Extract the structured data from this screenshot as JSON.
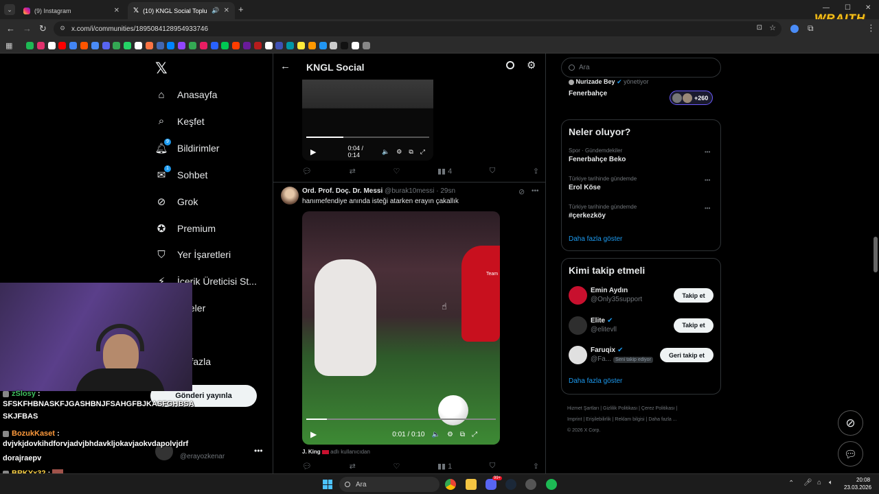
{
  "browser": {
    "tabs": [
      {
        "title": "(9) Instagram"
      },
      {
        "title": "(10) KNGL Social Topluluk /"
      }
    ],
    "url": "x.com/i/communities/1895084128954933746",
    "watermark": "WRAITH"
  },
  "nav": {
    "items": [
      {
        "label": "Anasayfa",
        "icon": "home-icon",
        "badge": ""
      },
      {
        "label": "Keşfet",
        "icon": "search-icon",
        "badge": ""
      },
      {
        "label": "Bildirimler",
        "icon": "bell-icon",
        "badge": "9"
      },
      {
        "label": "Sohbet",
        "icon": "mail-icon",
        "badge": "1"
      },
      {
        "label": "Grok",
        "icon": "grok-icon",
        "badge": ""
      },
      {
        "label": "Premium",
        "icon": "premium-icon",
        "badge": ""
      },
      {
        "label": "Yer İşaretleri",
        "icon": "bookmark-icon",
        "badge": ""
      },
      {
        "label": "İçerik Üreticisi St...",
        "icon": "creator-icon",
        "badge": ""
      },
      {
        "label": "kaleler",
        "icon": "articles-icon",
        "badge": ""
      },
      {
        "label": "fil",
        "icon": "profile-icon",
        "badge": ""
      },
      {
        "label": "ha fazla",
        "icon": "more-icon",
        "badge": ""
      }
    ],
    "post_button": "Gönderi yayınla",
    "account_name": "dorajraepv",
    "account_handle": "@erayozkenar"
  },
  "header": {
    "title": "KNGL Social"
  },
  "tweets": [
    {
      "video_time": "0:04 / 0:14",
      "video_progress": 0.3,
      "views": "4"
    },
    {
      "author": "Ord. Prof. Doç. Dr. Messi",
      "handle": "@burak10messi",
      "time": "· 29sn",
      "text": "hanımefendiye anında isteği atarken erayın çakallık",
      "video_time": "0:01 / 0:10",
      "video_progress": 0.11,
      "views": "1",
      "player_text": "Team"
    }
  ],
  "reply_bar": {
    "name": "J. King",
    "sub": "adlı kullanıcıdan"
  },
  "search": {
    "placeholder": "Ara"
  },
  "community": {
    "owner": "Nurizade Bey",
    "owner_suffix": "yönetiyor",
    "name": "Fenerbahçe",
    "members": "+260"
  },
  "trends": {
    "title": "Neler oluyor?",
    "items": [
      {
        "category": "Spor · Gündemdekiler",
        "name": "Fenerbahçe Beko"
      },
      {
        "category": "Türkiye tarihinde gündemde",
        "name": "Erol Köse"
      },
      {
        "category": "Türkiye tarihinde gündemde",
        "name": "#çerkezköy"
      }
    ],
    "more": "Daha fazla göster"
  },
  "who_to_follow": {
    "title": "Kimi takip etmeli",
    "items": [
      {
        "name": "Emin Aydın",
        "handle": "@Only35support",
        "button": "Takip et",
        "verified": false,
        "note": ""
      },
      {
        "name": "Elite",
        "handle": "@elitevll",
        "button": "Takip et",
        "verified": true,
        "note": ""
      },
      {
        "name": "Faruqix",
        "handle": "@Fa...",
        "button": "Geri takip et",
        "verified": true,
        "note": "Seni takip ediyor"
      }
    ],
    "more": "Daha fazla göster"
  },
  "footer": {
    "links": [
      "Hizmet Şartları",
      "Gizlilik Politikası",
      "Çerez Politikası",
      "Imprint",
      "Erişilebilirlik",
      "Reklam bilgisi",
      "Daha fazla ..."
    ],
    "copyright": "© 2026 X Corp."
  },
  "chat": [
    {
      "user": "zSlosy",
      "message": "SFSKFHBNASKFJGASHBNJFSAHGFBJKASFGHBSA SKJFBAS"
    },
    {
      "user": "BozukKaset",
      "message": "dvjvkjdovkihdforvjadvjbhdavkljokavjaokvdapolvjdrf"
    },
    {
      "user": "BRKYx32",
      "message": ""
    },
    {
      "user": "BatuKralinyoo",
      "message": ""
    }
  ],
  "taskbar": {
    "search_placeholder": "Ara",
    "time": "20:08",
    "date": "23.03.2026",
    "discord_badge": "99+"
  }
}
